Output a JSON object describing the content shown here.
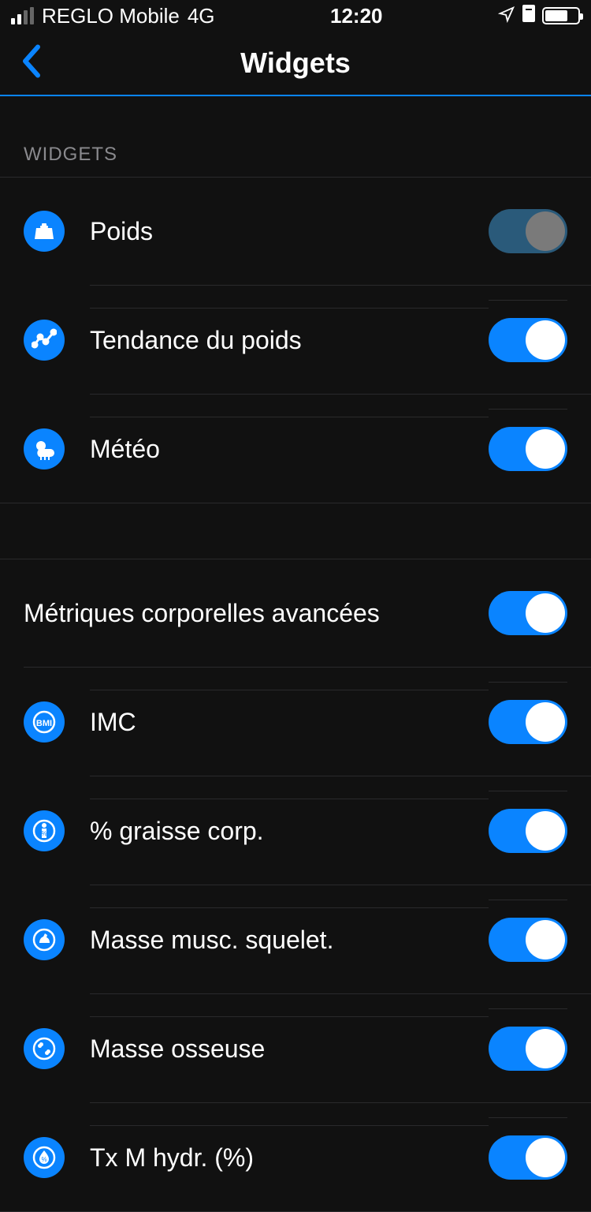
{
  "status": {
    "carrier": "REGLO Mobile",
    "network": "4G",
    "time": "12:20"
  },
  "nav": {
    "title": "Widgets"
  },
  "section1": {
    "header": "WIDGETS",
    "items": [
      {
        "label": "Poids",
        "icon": "weight-icon",
        "toggle": "locked"
      },
      {
        "label": "Tendance du poids",
        "icon": "trend-icon",
        "toggle": "on"
      },
      {
        "label": "Météo",
        "icon": "weather-icon",
        "toggle": "on"
      }
    ]
  },
  "section2": {
    "master": {
      "label": "Métriques corporelles avancées",
      "toggle": "on"
    },
    "items": [
      {
        "label": "IMC",
        "icon": "bmi-icon",
        "toggle": "on"
      },
      {
        "label": "% graisse corp.",
        "icon": "bodyfat-icon",
        "toggle": "on"
      },
      {
        "label": "Masse musc. squelet.",
        "icon": "muscle-icon",
        "toggle": "on"
      },
      {
        "label": "Masse osseuse",
        "icon": "bone-icon",
        "toggle": "on"
      },
      {
        "label": "Tx M hydr. (%)",
        "icon": "water-icon",
        "toggle": "on"
      }
    ]
  }
}
